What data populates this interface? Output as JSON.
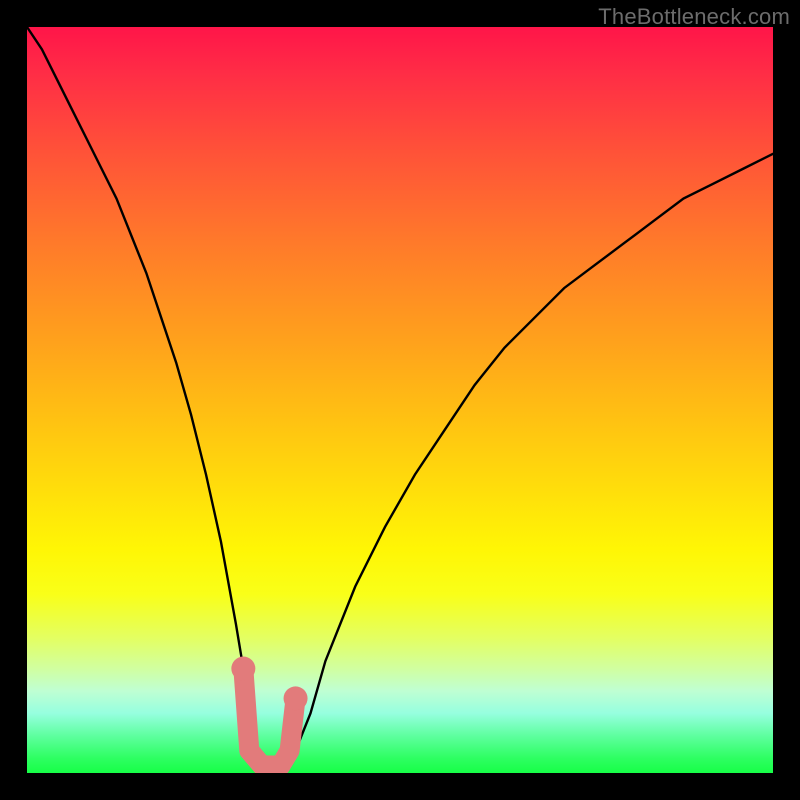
{
  "watermark": "TheBottleneck.com",
  "colors": {
    "frame": "#000000",
    "curve_stroke": "#000000",
    "marker_fill": "#e27b7b",
    "gradient_top": "#ff1549",
    "gradient_bottom": "#17ff47"
  },
  "chart_data": {
    "type": "line",
    "title": "",
    "xlabel": "",
    "ylabel": "",
    "xlim": [
      0,
      100
    ],
    "ylim": [
      0,
      100
    ],
    "x": [
      0,
      2,
      4,
      6,
      8,
      10,
      12,
      14,
      16,
      18,
      20,
      22,
      24,
      26,
      28,
      29,
      30,
      31,
      32,
      33,
      34,
      35,
      36,
      38,
      40,
      44,
      48,
      52,
      56,
      60,
      64,
      68,
      72,
      76,
      80,
      84,
      88,
      92,
      96,
      100
    ],
    "series": [
      {
        "name": "bottleneck-curve",
        "values": [
          100,
          97,
          93,
          89,
          85,
          81,
          77,
          72,
          67,
          61,
          55,
          48,
          40,
          31,
          20,
          14,
          8,
          3,
          1,
          0.5,
          0.5,
          1,
          3,
          8,
          15,
          25,
          33,
          40,
          46,
          52,
          57,
          61,
          65,
          68,
          71,
          74,
          77,
          79,
          81,
          83
        ]
      }
    ],
    "markers": [
      {
        "name": "left-endpoint",
        "x": 29.0,
        "y": 14.0
      },
      {
        "name": "left-bottom",
        "x": 29.8,
        "y": 3.0
      },
      {
        "name": "mid-left",
        "x": 31.5,
        "y": 1.0
      },
      {
        "name": "mid-right",
        "x": 34.0,
        "y": 1.0
      },
      {
        "name": "right-bottom",
        "x": 35.2,
        "y": 3.0
      },
      {
        "name": "right-endpoint",
        "x": 36.0,
        "y": 10.0
      }
    ],
    "minimum_region": {
      "x_start": 30,
      "x_end": 36
    }
  }
}
